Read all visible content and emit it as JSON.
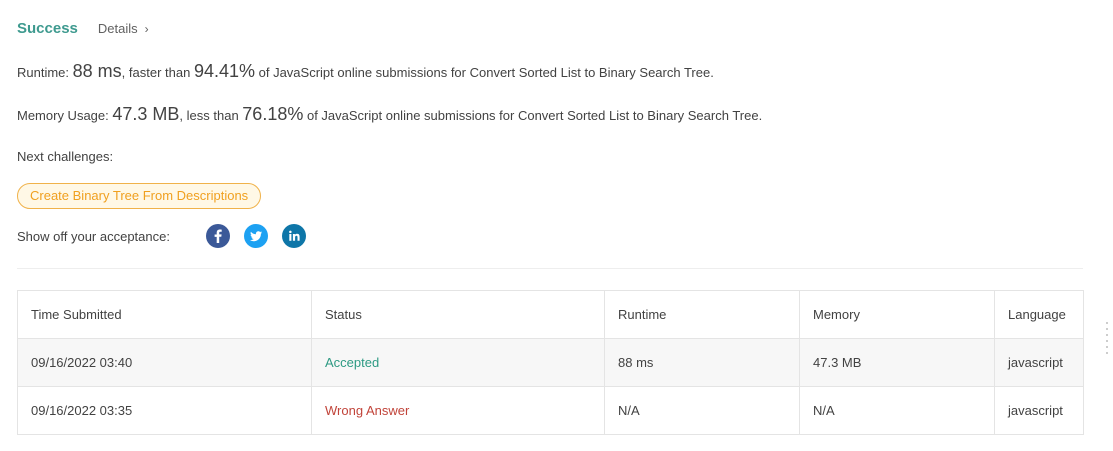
{
  "result": {
    "status": "Success",
    "details_label": "Details",
    "details_chevron": "›"
  },
  "runtime_stat": {
    "label": "Runtime: ",
    "value": "88 ms",
    "mid": ", faster than ",
    "percent": "94.41%",
    "suffix": " of JavaScript online submissions for Convert Sorted List to Binary Search Tree."
  },
  "memory_stat": {
    "label": "Memory Usage: ",
    "value": "47.3 MB",
    "mid": ", less than ",
    "percent": "76.18%",
    "suffix": " of JavaScript online submissions for Convert Sorted List to Binary Search Tree."
  },
  "next": {
    "label": "Next challenges:",
    "challenge": "Create Binary Tree From Descriptions"
  },
  "share": {
    "label": "Show off your acceptance:",
    "icons": [
      "facebook-icon",
      "twitter-icon",
      "linkedin-icon"
    ]
  },
  "table": {
    "headers": [
      "Time Submitted",
      "Status",
      "Runtime",
      "Memory",
      "Language"
    ],
    "rows": [
      {
        "time": "09/16/2022 03:40",
        "status": "Accepted",
        "runtime": "88 ms",
        "memory": "47.3 MB",
        "language": "javascript"
      },
      {
        "time": "09/16/2022 03:35",
        "status": "Wrong Answer",
        "runtime": "N/A",
        "memory": "N/A",
        "language": "javascript"
      }
    ]
  },
  "colors": {
    "success": "#3e9a8f",
    "accepted": "#2e9a83",
    "wrong_answer": "#c1443a",
    "challenge_border": "#f0b24a",
    "challenge_text": "#f0a020",
    "facebook": "#3b5998",
    "twitter": "#1da1f2",
    "linkedin": "#0e76a8"
  }
}
